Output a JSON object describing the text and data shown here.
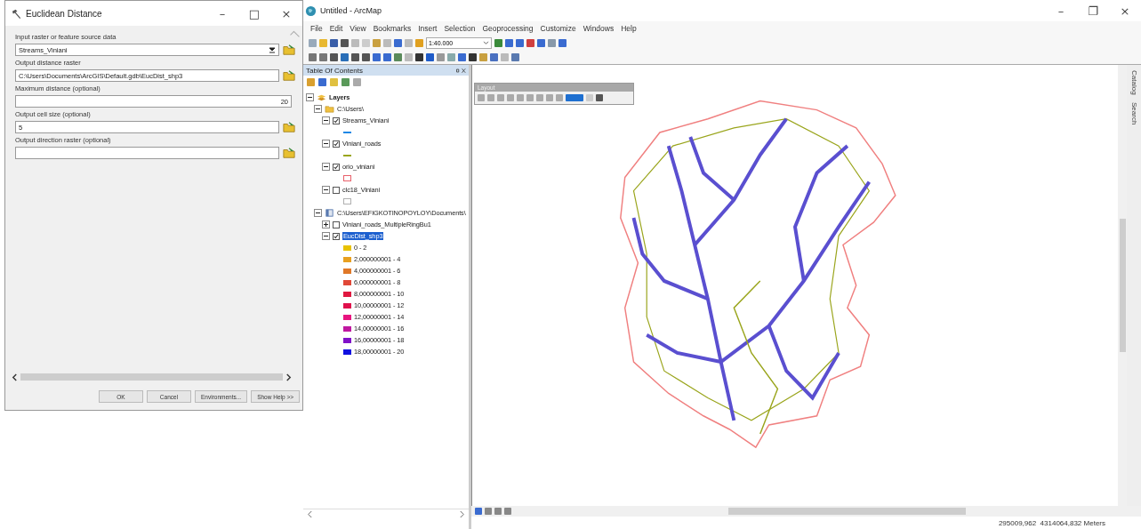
{
  "dialog": {
    "title": "Euclidean Distance",
    "window_controls": [
      "–",
      "□",
      "×"
    ],
    "fields": [
      {
        "label": "Input raster or feature source data",
        "value": "Streams_Viniani",
        "kind": "dropdown"
      },
      {
        "label": "Output distance raster",
        "value": "C:\\Users\\Documents\\ArcGIS\\Default.gdb\\EucDist_shp3",
        "kind": "browse"
      },
      {
        "label": "Maximum distance (optional)",
        "value": "20",
        "kind": "number"
      },
      {
        "label": "Output cell size (optional)",
        "value": "5",
        "kind": "browse"
      },
      {
        "label": "Output direction raster (optional)",
        "kind": "browse"
      }
    ],
    "buttons": [
      "OK",
      "Cancel",
      "Environments...",
      "Show Help >>"
    ]
  },
  "app": {
    "title": "Untitled - ArcMap",
    "window_controls": [
      "–",
      "❐",
      "×"
    ],
    "menu": [
      "File",
      "Edit",
      "View",
      "Bookmarks",
      "Insert",
      "Selection",
      "Geoprocessing",
      "Customize",
      "Windows",
      "Help"
    ],
    "scale": "1:40.000",
    "toc": {
      "title": "Table Of Contents",
      "tree": [
        {
          "label": "Layers",
          "kind": "frame",
          "expanded": true,
          "children": [
            {
              "label": "C:\\Users\\",
              "kind": "folder",
              "expanded": true,
              "children": [
                {
                  "label": "Streams_Viniani",
                  "kind": "layer",
                  "expanded": true,
                  "checked": true,
                  "selected": false,
                  "legend": [
                    {
                      "kind": "line",
                      "color": "#1e88e5"
                    }
                  ]
                },
                {
                  "label": "Viniani_roads",
                  "kind": "layer",
                  "expanded": true,
                  "checked": true,
                  "selected": false,
                  "legend": [
                    {
                      "kind": "line",
                      "color": "#9aa51c"
                    }
                  ]
                },
                {
                  "label": "orio_viniani",
                  "kind": "layer",
                  "expanded": true,
                  "checked": true,
                  "selected": false,
                  "legend": [
                    {
                      "kind": "outline",
                      "color": "#e8606a"
                    }
                  ]
                },
                {
                  "label": "clc18_Viniani",
                  "kind": "layer",
                  "expanded": true,
                  "checked": false,
                  "selected": false,
                  "legend": [
                    {
                      "kind": "outline",
                      "color": "#b0b0b0"
                    }
                  ]
                }
              ]
            },
            {
              "label": "C:\\Users\\EFIGKOTINOPOYLOY\\Documents\\",
              "kind": "database",
              "expanded": true,
              "children": [
                {
                  "label": "Viniani_roads_MultipleRingBu1",
                  "kind": "layer",
                  "expanded": false,
                  "checked": false,
                  "selected": false
                },
                {
                  "label": "EucDist_shp3",
                  "kind": "layer",
                  "expanded": true,
                  "checked": true,
                  "selected": true,
                  "legend": [
                    {
                      "kind": "fill",
                      "color": "#e8c200",
                      "label": "0 - 2"
                    },
                    {
                      "kind": "fill",
                      "color": "#e8a020",
                      "label": "2,000000001 - 4"
                    },
                    {
                      "kind": "fill",
                      "color": "#e07828",
                      "label": "4,000000001 - 6"
                    },
                    {
                      "kind": "fill",
                      "color": "#e04838",
                      "label": "6,000000001 - 8"
                    },
                    {
                      "kind": "fill",
                      "color": "#e01840",
                      "label": "8,000000001 - 10"
                    },
                    {
                      "kind": "fill",
                      "color": "#e0104c",
                      "label": "10,00000001 - 12"
                    },
                    {
                      "kind": "fill",
                      "color": "#e81480",
                      "label": "12,00000001 - 14"
                    },
                    {
                      "kind": "fill",
                      "color": "#c018a0",
                      "label": "14,00000001 - 16"
                    },
                    {
                      "kind": "fill",
                      "color": "#8010c8",
                      "label": "16,00000001 - 18"
                    },
                    {
                      "kind": "fill",
                      "color": "#1010e0",
                      "label": "18,00000001 - 20"
                    }
                  ]
                }
              ]
            }
          ]
        }
      ]
    },
    "layout_toolbar": {
      "title": "Layout"
    },
    "side_tabs": [
      "Catalog",
      "Search"
    ],
    "status_bar": "295009,962  4314064,832 Meters"
  }
}
